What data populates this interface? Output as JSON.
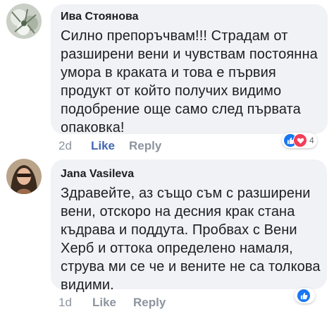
{
  "colors": {
    "bubble_bg": "#f0f2f5",
    "like_blue": "#4267b2",
    "meta_gray": "#8d949e",
    "love_red": "#f33e58",
    "like_icon_blue": "#1877f2"
  },
  "comments": [
    {
      "author": "Ива Стоянова",
      "text": "Силно препоръчвам!!! Страдам от\nразширени вени и чувствам постоянна\nумора в краката и това е първия\nпродукт от който получих видимо\nподобрение още само след първата\nопаковка!",
      "age": "2d",
      "like_label": "Like",
      "reply_label": "Reply",
      "reactions": [
        "like-icon",
        "love-icon"
      ],
      "reaction_count": "4"
    },
    {
      "author": "Jana Vasileva",
      "text": "Здравейте, аз също съм с разширени\nвени, отскоро на десния крак стана\nкъдрава и поддута. Пробвах с Вени\nХерб и оттока определено намаля,\nструва ми се че и вените не са толкова\nвидими.",
      "age": "1d",
      "like_label": "Like",
      "reply_label": "Reply",
      "reactions": [
        "like-icon"
      ],
      "reaction_count": ""
    }
  ]
}
